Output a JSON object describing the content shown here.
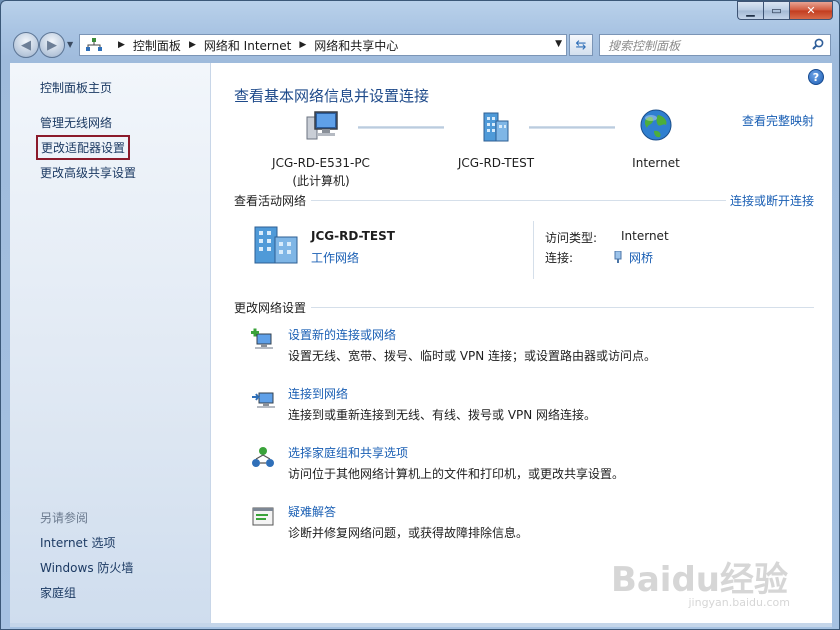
{
  "window": {
    "caption": {
      "minimize": "▁",
      "maximize": "▭",
      "close": "✕"
    }
  },
  "toolbar": {
    "back_icon": "back-arrow-icon",
    "forward_icon": "forward-arrow-icon",
    "breadcrumbs": [
      "控制面板",
      "网络和 Internet",
      "网络和共享中心"
    ],
    "search_placeholder": "搜索控制面板"
  },
  "sidebar": {
    "items": [
      {
        "label": "控制面板主页"
      },
      {
        "label": "管理无线网络"
      },
      {
        "label": "更改适配器设置"
      },
      {
        "label": "更改高级共享设置"
      }
    ],
    "see_also_title": "另请参阅",
    "see_also": [
      {
        "label": "Internet 选项"
      },
      {
        "label": "Windows 防火墙"
      },
      {
        "label": "家庭组"
      }
    ]
  },
  "main": {
    "title": "查看基本网络信息并设置连接",
    "full_map_link": "查看完整映射",
    "map": {
      "computer_name": "JCG-RD-E531-PC",
      "computer_sub": "(此计算机)",
      "network_name": "JCG-RD-TEST",
      "internet_name": "Internet"
    },
    "active_networks_heading": "查看活动网络",
    "connect_link": "连接或断开连接",
    "active_network": {
      "name": "JCG-RD-TEST",
      "type": "工作网络",
      "access_type_label": "访问类型:",
      "access_type_value": "Internet",
      "connections_label": "连接:",
      "connections_value": "网桥"
    },
    "change_settings_heading": "更改网络设置",
    "tasks": [
      {
        "link": "设置新的连接或网络",
        "desc": "设置无线、宽带、拨号、临时或 VPN 连接；或设置路由器或访问点。"
      },
      {
        "link": "连接到网络",
        "desc": "连接到或重新连接到无线、有线、拨号或 VPN 网络连接。"
      },
      {
        "link": "选择家庭组和共享选项",
        "desc": "访问位于其他网络计算机上的文件和打印机，或更改共享设置。"
      },
      {
        "link": "疑难解答",
        "desc": "诊断并修复网络问题，或获得故障排除信息。"
      }
    ]
  },
  "watermark": {
    "main": "Baidu经验",
    "sub": "jingyan.baidu.com"
  },
  "colors": {
    "link": "#1a5fb4",
    "title": "#1e4a8a",
    "highlight_border": "#8b1a2b"
  }
}
